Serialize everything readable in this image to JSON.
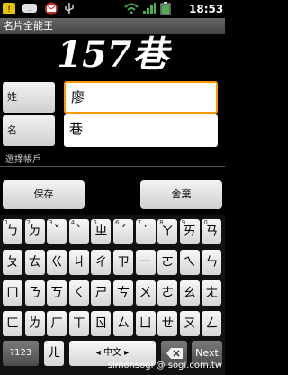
{
  "status_bar": {
    "time": "18:53",
    "icons": [
      "notification-icon",
      "sms-icon",
      "mail-icon",
      "usb-icon",
      "wifi-icon",
      "signal-icon",
      "battery-icon"
    ]
  },
  "app": {
    "title": "名片全能王"
  },
  "hero": {
    "text": "157巷"
  },
  "form": {
    "last_name_label": "姓",
    "last_name_value": "廖",
    "first_name_label": "名",
    "first_name_value": "巷",
    "account_label": "選擇帳戶"
  },
  "actions": {
    "save": "保存",
    "discard": "舍棄"
  },
  "keyboard": {
    "rows": [
      [
        {
          "k": "ㄅ",
          "h": "1"
        },
        {
          "k": "ㄉ",
          "h": "2"
        },
        {
          "k": "ˇ",
          "h": "3"
        },
        {
          "k": "ˋ",
          "h": "4"
        },
        {
          "k": "ㄓ",
          "h": "5"
        },
        {
          "k": "ˊ",
          "h": "6"
        },
        {
          "k": "˙",
          "h": "7"
        },
        {
          "k": "ㄚ",
          "h": "8"
        },
        {
          "k": "ㄞ",
          "h": "9"
        },
        {
          "k": "ㄢ",
          "h": "0"
        }
      ],
      [
        {
          "k": "ㄆ",
          "h": ""
        },
        {
          "k": "ㄊ",
          "h": ""
        },
        {
          "k": "ㄍ",
          "h": ""
        },
        {
          "k": "ㄐ",
          "h": ""
        },
        {
          "k": "ㄔ",
          "h": ""
        },
        {
          "k": "ㄗ",
          "h": ""
        },
        {
          "k": "ㄧ",
          "h": ""
        },
        {
          "k": "ㄛ",
          "h": ""
        },
        {
          "k": "ㄟ",
          "h": ""
        },
        {
          "k": "ㄣ",
          "h": ""
        }
      ],
      [
        {
          "k": "ㄇ",
          "h": ""
        },
        {
          "k": "ㄋ",
          "h": ""
        },
        {
          "k": "ㄎ",
          "h": ""
        },
        {
          "k": "ㄑ",
          "h": ""
        },
        {
          "k": "ㄕ",
          "h": ""
        },
        {
          "k": "ㄘ",
          "h": ""
        },
        {
          "k": "ㄨ",
          "h": ""
        },
        {
          "k": "ㄜ",
          "h": ""
        },
        {
          "k": "ㄠ",
          "h": ""
        },
        {
          "k": "ㄤ",
          "h": ""
        }
      ],
      [
        {
          "k": "ㄈ",
          "h": ""
        },
        {
          "k": "ㄌ",
          "h": ""
        },
        {
          "k": "ㄏ",
          "h": ""
        },
        {
          "k": "ㄒ",
          "h": ""
        },
        {
          "k": "ㄖ",
          "h": ""
        },
        {
          "k": "ㄙ",
          "h": ""
        },
        {
          "k": "ㄩ",
          "h": ""
        },
        {
          "k": "ㄝ",
          "h": ""
        },
        {
          "k": "ㄡ",
          "h": ""
        },
        {
          "k": "ㄥ",
          "h": ""
        }
      ]
    ],
    "bottom": {
      "sym": "?123",
      "er": "ㄦ",
      "lang": "◂ 中文 ▸",
      "next": "Next"
    }
  },
  "watermark": "simonsogi @ sogi.com.tw"
}
